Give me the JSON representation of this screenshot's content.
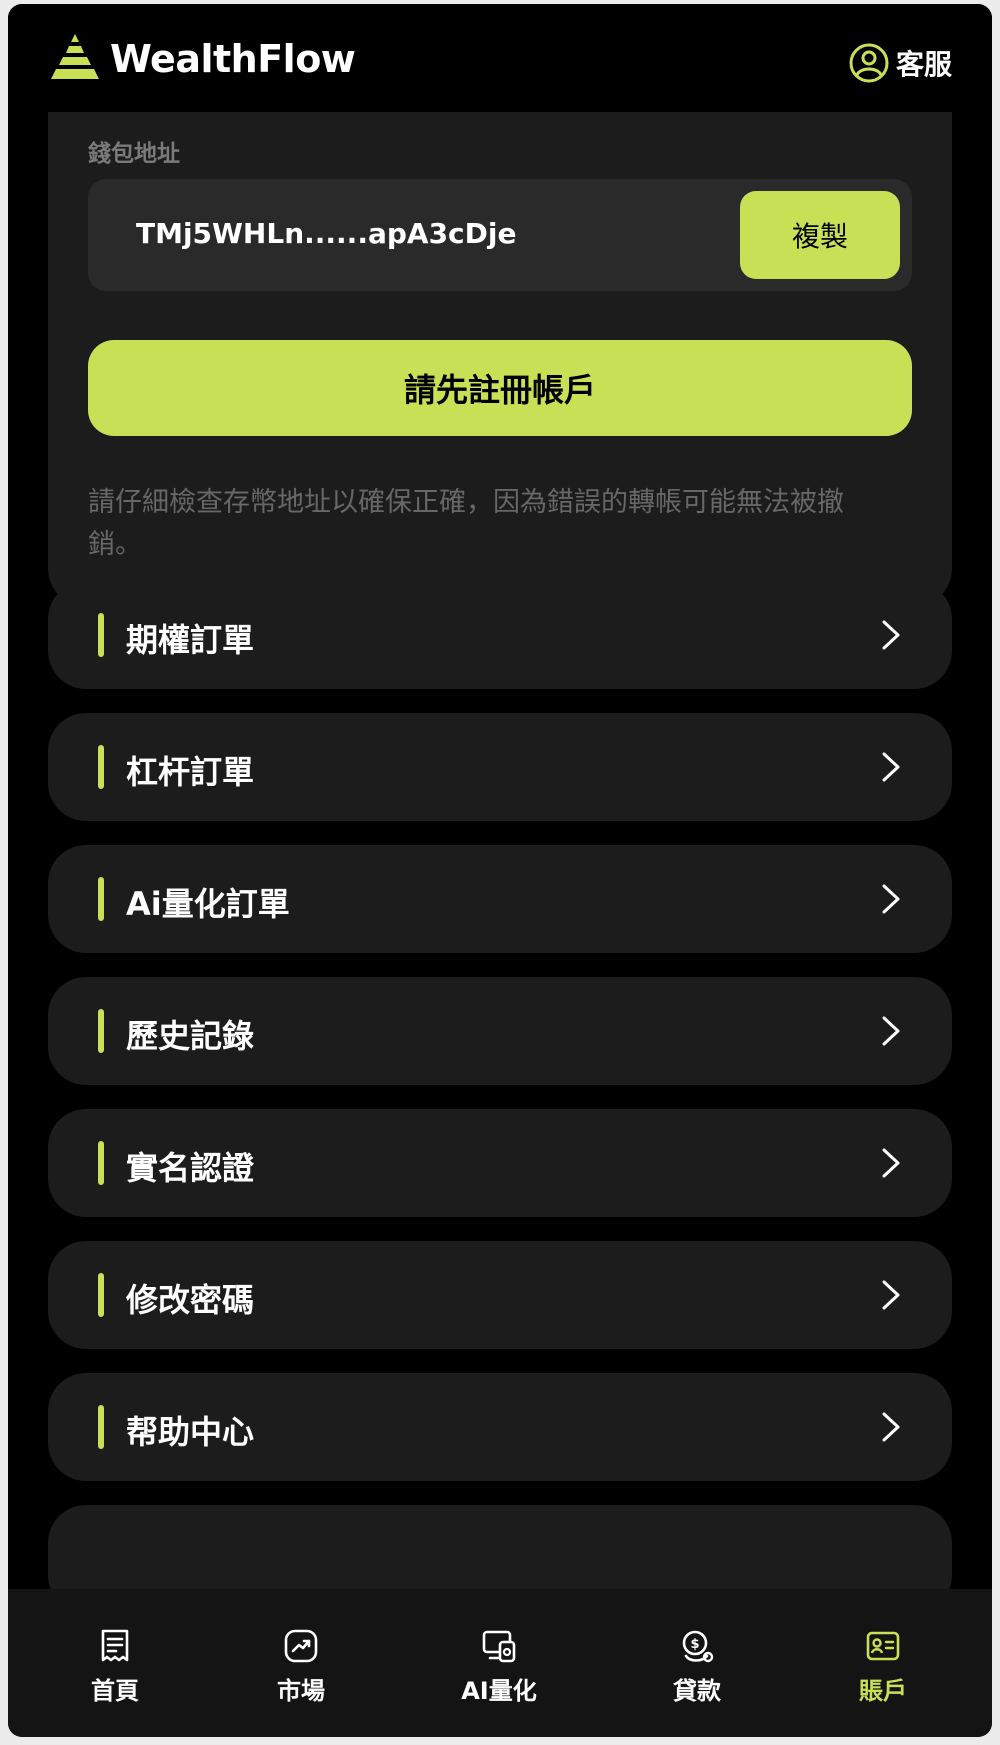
{
  "header": {
    "brand": "WealthFlow",
    "service_label": "客服"
  },
  "wallet": {
    "label": "錢包地址",
    "address": "TMj5WHLn......apA3cDje",
    "copy_label": "複製",
    "register_label": "請先註冊帳戶",
    "warning": "請仔細檢查存幣地址以確保正確，因為錯誤的轉帳可能無法被撤銷。"
  },
  "menu": {
    "items": [
      {
        "label": "期權訂單"
      },
      {
        "label": "杠杆訂單"
      },
      {
        "label": "Ai量化訂單"
      },
      {
        "label": "歷史記錄"
      },
      {
        "label": "實名認證"
      },
      {
        "label": "修改密碼"
      },
      {
        "label": "帮助中心"
      }
    ]
  },
  "nav": {
    "items": [
      {
        "label": "首頁",
        "icon": "receipt-icon"
      },
      {
        "label": "市場",
        "icon": "chart-icon"
      },
      {
        "label": "AI量化",
        "icon": "robot-icon"
      },
      {
        "label": "貸款",
        "icon": "coin-icon"
      },
      {
        "label": "賬戶",
        "icon": "id-card-icon",
        "active": true
      }
    ]
  },
  "colors": {
    "accent": "#c8e056",
    "background": "#000000",
    "card": "#1c1c1c"
  }
}
